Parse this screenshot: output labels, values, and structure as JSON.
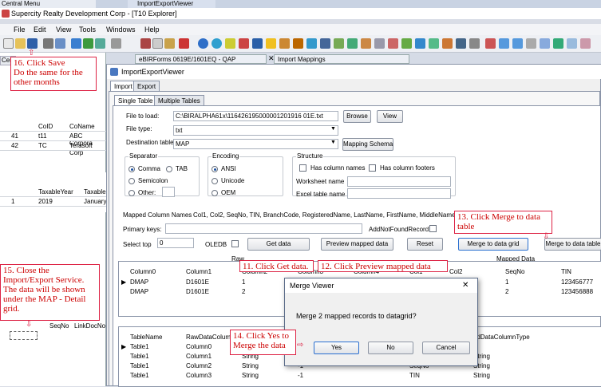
{
  "bg_windows": {
    "central_menu": "Central Menu",
    "import_export_viewer_tab": "ImportExportViewer"
  },
  "app_title": "Supercity Realty Development Corp - [T10 Explorer]",
  "menu": [
    "File",
    "Edit",
    "View",
    "Tools",
    "Windows",
    "Help"
  ],
  "doc_tabs": [
    "eBIRForms 0619E/1601EQ - QAP",
    "Import Mappings"
  ],
  "left": {
    "tab": "Centr",
    "grid1": {
      "headers": [
        "CoID",
        "CoName"
      ],
      "rows": [
        [
          "41",
          "t11",
          "ABC Corpora"
        ],
        [
          "42",
          "TC",
          "Terasoft Corp"
        ]
      ]
    },
    "grid2": {
      "headers": [
        "TaxableYear",
        "Taxable"
      ],
      "rows": [
        [
          "1",
          "2019",
          "January"
        ]
      ]
    },
    "grid3": {
      "headers": [
        "SeqNo",
        "LinkDocNo"
      ]
    }
  },
  "window": {
    "title": "ImportExportViewer",
    "tabs": [
      "Import",
      "Export"
    ],
    "subtabs": [
      "Single Table",
      "Multiple Tables"
    ],
    "file_label": "File to load:",
    "file_value": "C:\\BIRALPHA61x\\116426195000001201916 01E.txt",
    "browse": "Browse",
    "view": "View",
    "filetype_label": "File type:",
    "filetype_value": "txt",
    "dest_label": "Destination table:",
    "dest_value": "MAP",
    "mapping_schema": "Mapping Schema",
    "separator": {
      "title": "Separator",
      "comma": "Comma",
      "tab": "TAB",
      "semicolon": "Semicolon",
      "other": "Other:"
    },
    "encoding": {
      "title": "Encoding",
      "ansi": "ANSI",
      "unicode": "Unicode",
      "oem": "OEM"
    },
    "structure": {
      "title": "Structure",
      "has_names": "Has column names",
      "has_footers": "Has column footers",
      "worksheet": "Worksheet name",
      "excel_table": "Excel table name"
    },
    "mapped_label": "Mapped Column Names",
    "mapped_value": "Col1, Col2, SeqNo, TIN, BranchCode, RegisteredName, LastName, FirstName, MiddleName, Month",
    "primary_keys": "Primary keys:",
    "add_not_found": "AddNotFoundRecord",
    "select_top": "Select top",
    "select_top_value": "0",
    "oledb": "OLEDB",
    "get_data": "Get data",
    "preview": "Preview mapped data",
    "reset": "Reset",
    "merge_grid": "Merge to data grid",
    "merge_table": "Merge to data table",
    "raw_label": "Raw",
    "mapped_data_label": "Mapped Data",
    "grid_top": {
      "headers": [
        "Column0",
        "Column1",
        "Column2",
        "Column3",
        "Column4",
        "Col1",
        "Col2",
        "SeqNo",
        "TIN"
      ],
      "rows": [
        [
          "DMAP",
          "D1601E",
          "1",
          "",
          "",
          "",
          "",
          "1",
          "123456777"
        ],
        [
          "DMAP",
          "D1601E",
          "2",
          "",
          "",
          "",
          "",
          "2",
          "123456888"
        ]
      ]
    },
    "grid_bottom": {
      "headers": [
        "TableName",
        "RawDataColumn",
        "",
        "",
        "",
        "edDataColumnType"
      ],
      "rows": [
        [
          "Table1",
          "Column0",
          "",
          "",
          "",
          ""
        ],
        [
          "Table1",
          "Column1",
          "String",
          "",
          "",
          "String"
        ],
        [
          "Table1",
          "Column2",
          "String",
          "-1",
          "SeqNo",
          "String"
        ],
        [
          "Table1",
          "Column3",
          "String",
          "-1",
          "TIN",
          "String"
        ]
      ]
    }
  },
  "dialog": {
    "title": "Merge Viewer",
    "message": "Merge 2 mapped records to datagrid?",
    "yes": "Yes",
    "no": "No",
    "cancel": "Cancel"
  },
  "callouts": {
    "c16": "16. Click Save\nDo the same for the other months",
    "c15": "15. Close the Import/Export Service. The data will be shown under the MAP - Detail grid.",
    "c11": "11. Click Get data.",
    "c12": "12. Click Preview mapped data",
    "c13": "13. Click Merge to data table",
    "c14": "14. Click Yes to Merge the data"
  },
  "colors": {
    "callout_border": "#dd2244",
    "callout_text": "#cc0000",
    "accent": "#1a4fa0"
  }
}
